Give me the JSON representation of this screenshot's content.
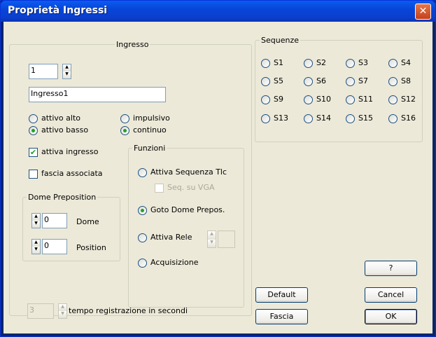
{
  "window": {
    "title": "Proprietà Ingressi",
    "close_glyph": "✕"
  },
  "ingresso": {
    "legend": "Ingresso",
    "number_value": "1",
    "name_value": "Ingresso1",
    "attivo_alto": "attivo alto",
    "attivo_basso": "attivo basso",
    "impulsivo": "impulsivo",
    "continuo": "continuo",
    "attiva_ingresso": "attiva ingresso",
    "fascia_associata": "fascia associata",
    "attiva_ingresso_checked": true,
    "fascia_associata_checked": false,
    "selected_polarity": "attivo basso",
    "selected_mode": "continuo"
  },
  "dome": {
    "legend": "Dome Preposition",
    "dome_value": "0",
    "dome_label": "Dome",
    "position_value": "0",
    "position_label": "Position"
  },
  "funzioni": {
    "legend": "Funzioni",
    "attiva_sequenza": "Attiva Sequenza Tlc",
    "seq_vga": "Seq. su VGA",
    "goto_dome": "Goto Dome Prepos.",
    "attiva_rele": "Attiva Rele",
    "acquisizione": "Acquisizione",
    "selected": "Goto Dome Prepos."
  },
  "sequenze": {
    "legend": "Sequenze",
    "items": [
      "S1",
      "S2",
      "S3",
      "S4",
      "S5",
      "S6",
      "S7",
      "S8",
      "S9",
      "S10",
      "S11",
      "S12",
      "S13",
      "S14",
      "S15",
      "S16"
    ]
  },
  "tempo": {
    "value": "3",
    "label": "tempo registrazione in secondi"
  },
  "buttons": {
    "help": "?",
    "default": "Default",
    "cancel": "Cancel",
    "fascia": "Fascia",
    "ok": "OK"
  },
  "colors": {
    "title_bar": "#0845d8",
    "dialog_bg": "#ece9d8",
    "radio_dot": "#21a121"
  }
}
